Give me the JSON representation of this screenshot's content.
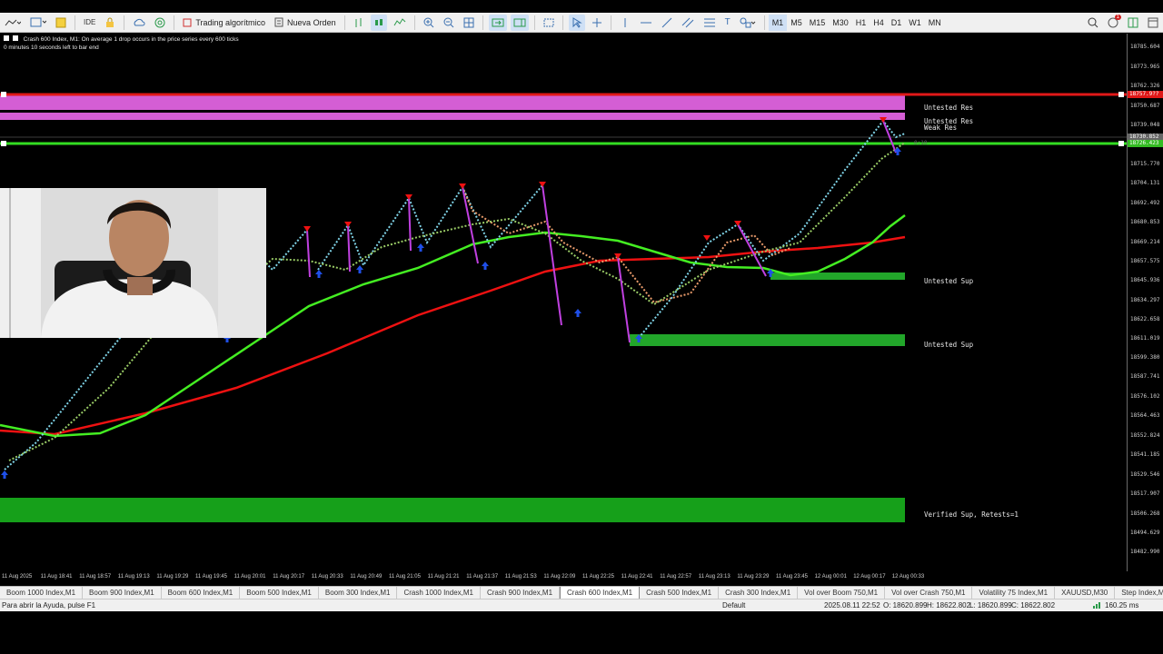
{
  "toolbar": {
    "algo_label": "Trading algorítmico",
    "order_label": "Nueva Orden",
    "timeframes": [
      "M1",
      "M5",
      "M15",
      "M30",
      "H1",
      "H4",
      "D1",
      "W1",
      "MN"
    ],
    "active_timeframe": "M1",
    "notification_count": "1"
  },
  "chart": {
    "title": "Crash 600 Index, M1:  On average 1 drop occurs in the price series every 600 ticks",
    "countdown": "0 minutes 10 seconds left to bar end",
    "zones": [
      {
        "label": "Untested Res"
      },
      {
        "label": "Untested Res"
      },
      {
        "label": "Weak Res"
      },
      {
        "label": "Untested Sup"
      },
      {
        "label": "Untested Sup"
      },
      {
        "label": "Verified Sup, Retests=1"
      }
    ],
    "price_ticks": [
      "18785.604",
      "18773.965",
      "18762.326",
      "18750.687",
      "18739.048",
      "18715.770",
      "18704.131",
      "18692.492",
      "18680.853",
      "18669.214",
      "18657.575",
      "18645.936",
      "18634.297",
      "18622.658",
      "18611.019",
      "18599.380",
      "18587.741",
      "18576.102",
      "18564.463",
      "18552.824",
      "18541.185",
      "18529.546",
      "18517.907",
      "18506.268",
      "18494.629",
      "18482.990"
    ],
    "price_badges": {
      "red": "18757.9??",
      "grey": "18730.852",
      "green": "18726.423"
    },
    "time_ticks": [
      "11 Aug 2025",
      "11 Aug 18:41",
      "11 Aug 18:57",
      "11 Aug 19:13",
      "11 Aug 19:29",
      "11 Aug 19:45",
      "11 Aug 20:01",
      "11 Aug 20:17",
      "11 Aug 20:33",
      "11 Aug 20:49",
      "11 Aug 21:05",
      "11 Aug 21:21",
      "11 Aug 21:37",
      "11 Aug 21:53",
      "11 Aug 22:09",
      "11 Aug 22:25",
      "11 Aug 22:41",
      "11 Aug 22:57",
      "11 Aug 23:13",
      "11 Aug 23:29",
      "11 Aug 23:45",
      "12 Aug 00:01",
      "12 Aug 00:17",
      "12 Aug 00:33"
    ],
    "colors": {
      "green_ma": "#44ee22",
      "red_ma": "#ee1111",
      "res_zone": "#d45ed4",
      "sup_zone": "#22a62a",
      "up_tick": "#7fd4e8",
      "down_tick": "#e89a6a",
      "spike": "#c040e0"
    }
  },
  "symbol_tabs": [
    "Boom 1000 Index,M1",
    "Boom 900 Index,M1",
    "Boom 600 Index,M1",
    "Boom 500 Index,M1",
    "Boom 300 Index,M1",
    "Crash 1000 Index,M1",
    "Crash 900 Index,M1",
    "Crash 600 Index,M1",
    "Crash 500 Index,M1",
    "Crash 300 Index,M1",
    "Vol over Boom 750,M1",
    "Vol over Crash 750,M1",
    "Volatility 75 Index,M1",
    "XAUUSD,M30",
    "Step Index,M"
  ],
  "active_tab": "Crash 600 Index,M1",
  "status": {
    "help": "Para abrir la Ayuda, pulse F1",
    "profile": "Default",
    "datetime": "2025.08.11 22:52",
    "open": "O: 18620.899",
    "high": "H: 18622.802",
    "low": "L: 18620.899",
    "close": "C: 18622.802",
    "ping": "160.25 ms"
  }
}
